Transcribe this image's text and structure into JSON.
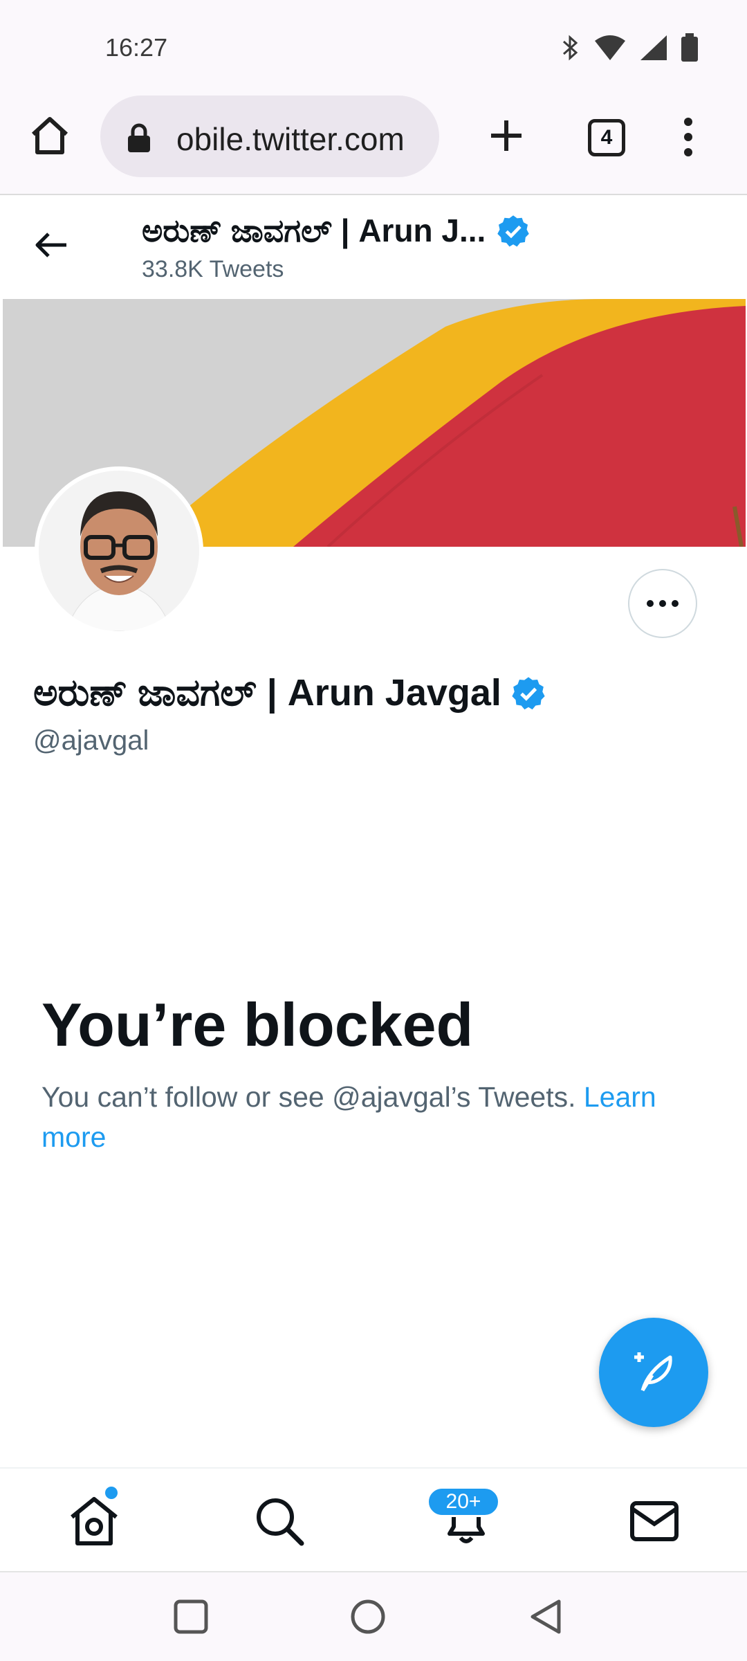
{
  "status_bar": {
    "time": "16:27",
    "icons": [
      "bluetooth-icon",
      "wifi-icon",
      "signal-icon",
      "battery-icon"
    ]
  },
  "browser": {
    "url": "obile.twitter.com",
    "tab_count": "4",
    "icons": [
      "home-icon",
      "lock-icon",
      "new-tab-icon",
      "tabs-icon",
      "menu-icon"
    ]
  },
  "header": {
    "name": "ಅರುಣ್ ಜಾವಗಲ್ | Arun J...",
    "tweet_count": "33.8K Tweets"
  },
  "profile": {
    "name": "ಅರುಣ್ ಜಾವಗಲ್ | Arun Javgal",
    "handle": "@ajavgal"
  },
  "blocked": {
    "title": "You’re blocked",
    "message": "You can’t follow or see @ajavgal’s Tweets. ",
    "link": "Learn more"
  },
  "bottom_nav": {
    "items": [
      "home",
      "search",
      "notifications",
      "messages"
    ],
    "notification_badge": "20+"
  },
  "colors": {
    "accent": "#1d9bf0",
    "text": "#0f1419",
    "secondary_text": "#536471",
    "flag_yellow": "#f2b51e",
    "flag_red": "#cf323f"
  }
}
